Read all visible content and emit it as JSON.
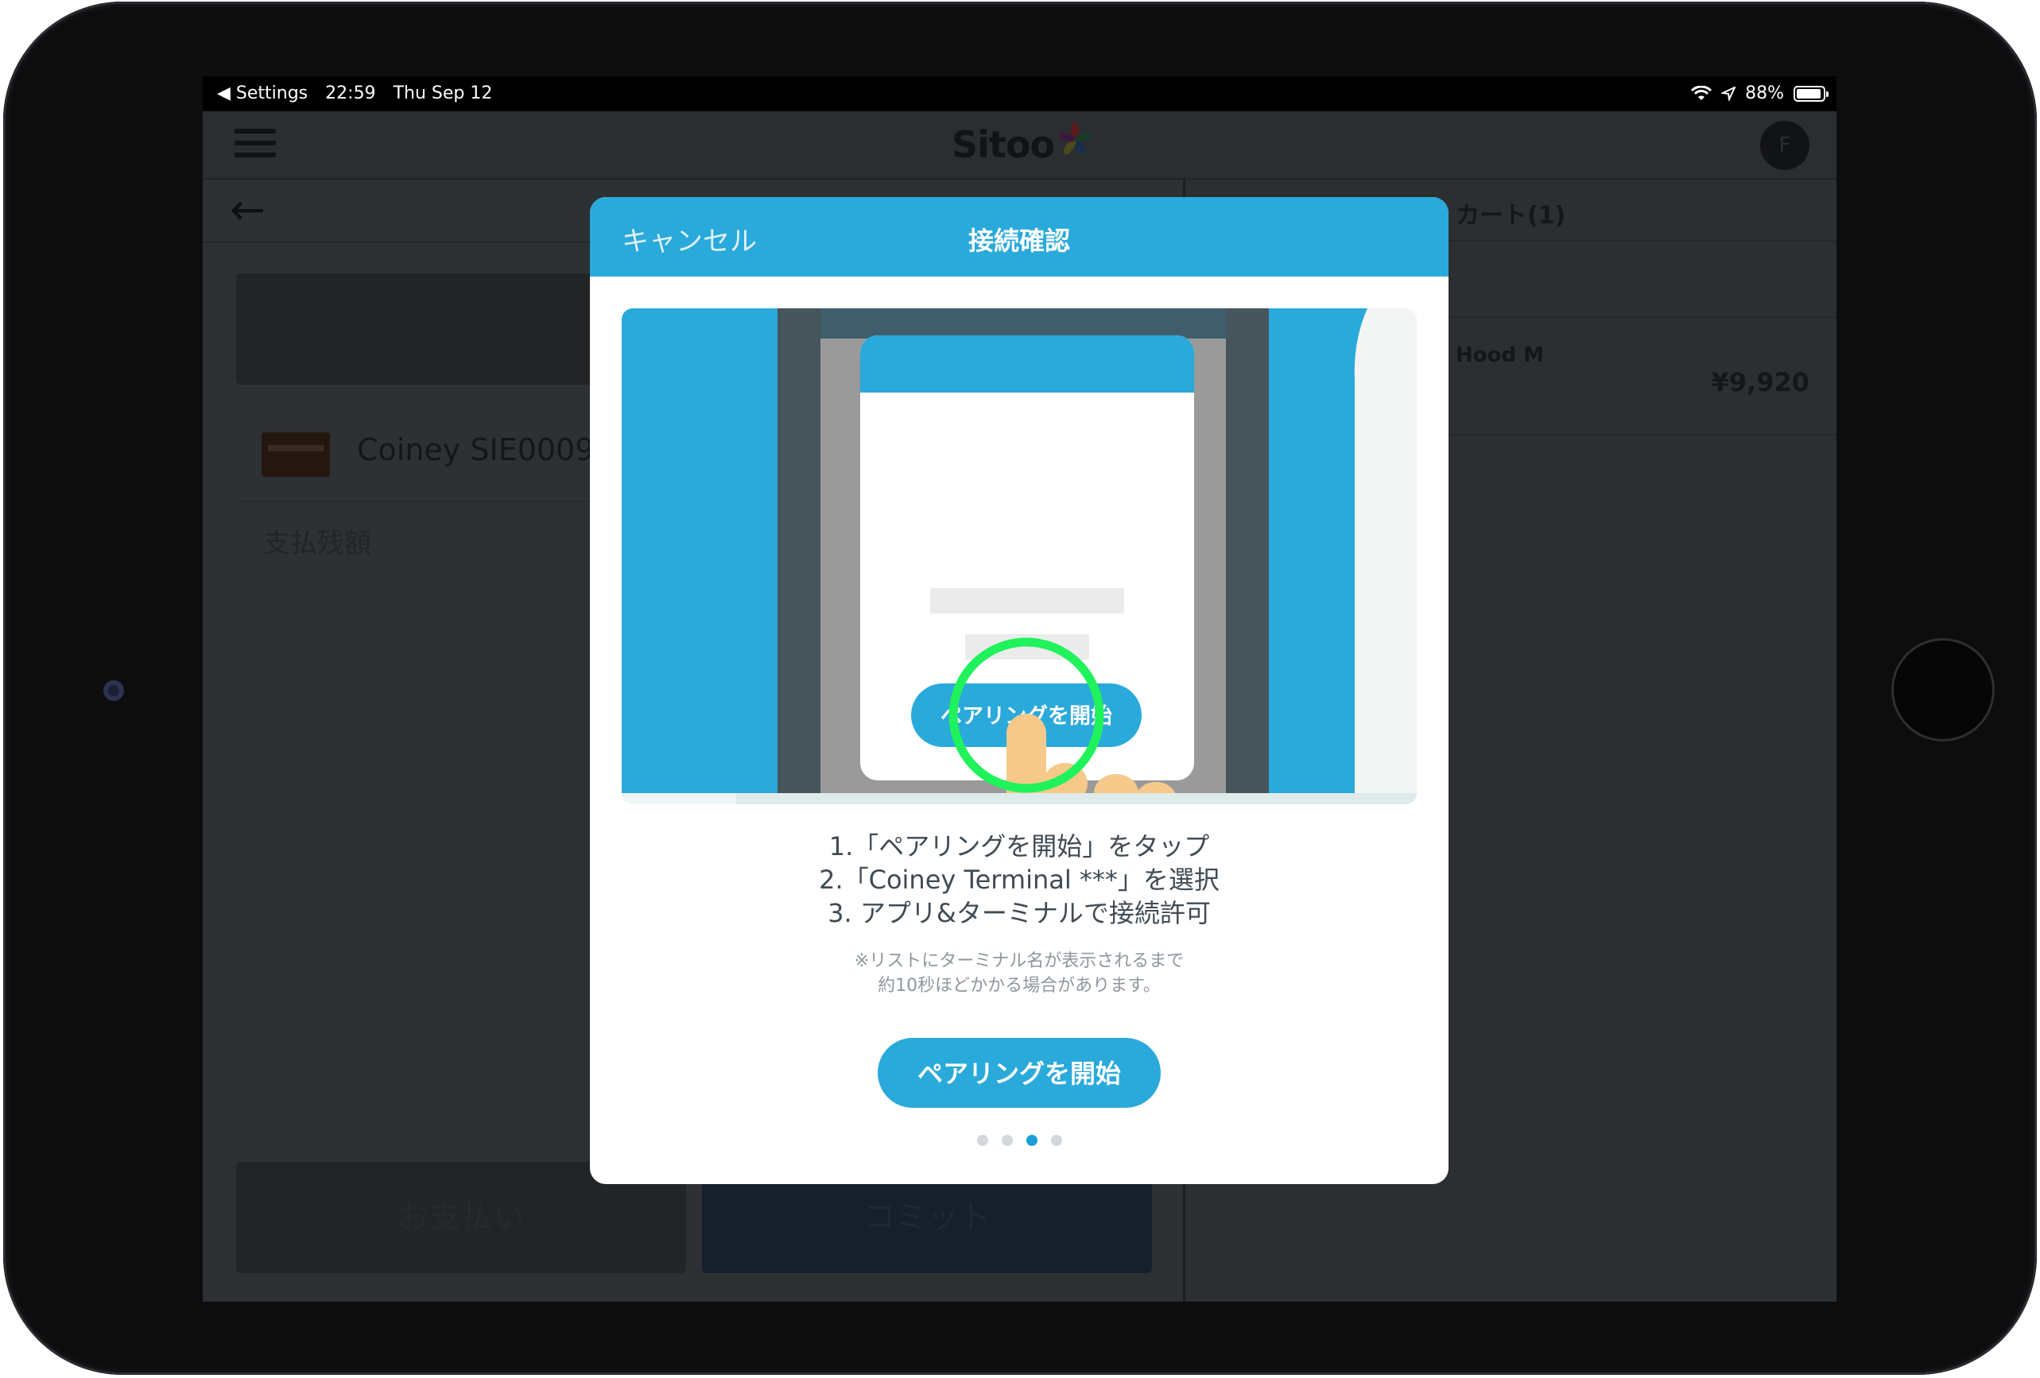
{
  "status_bar": {
    "back_app": "◀ Settings",
    "time": "22:59",
    "date": "Thu Sep 12",
    "battery": "88%"
  },
  "app": {
    "logo_text": "Sitoo",
    "avatar_initial": "F"
  },
  "left_pane": {
    "payment_method": "Coiney SIE000904",
    "balance_label": "支払残額",
    "pay_button": "お支払い",
    "commit_button": "コミット"
  },
  "cart": {
    "title": "カート(1)",
    "items": [
      {
        "name": "Hood M",
        "price": "¥9,920"
      }
    ]
  },
  "modal": {
    "cancel": "キャンセル",
    "title": "接続確認",
    "illustration_button": "ペアリングを開始",
    "steps": [
      "1.「ペアリングを開始」をタップ",
      "2.「Coiney Terminal ***」を選択",
      "3. アプリ&ターミナルで接続許可"
    ],
    "note": [
      "※リストにターミナル名が表示されるまで",
      "約10秒ほどかかる場合があります。"
    ],
    "pair_button": "ペアリングを開始",
    "page_indicator": {
      "current": 3,
      "total": 4
    }
  },
  "colors": {
    "accent": "#2aa9db",
    "highlight_ring": "#1ff25b"
  }
}
